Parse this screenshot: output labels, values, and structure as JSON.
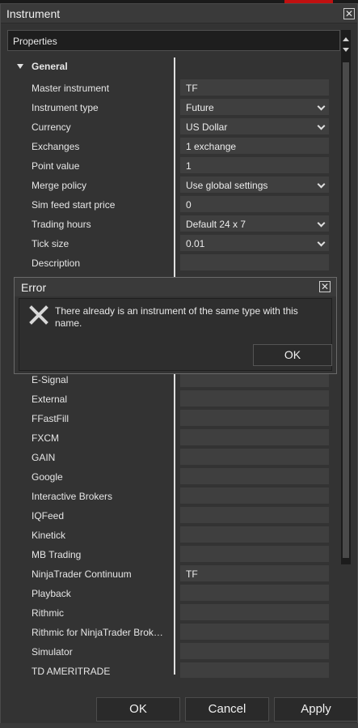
{
  "window": {
    "title": "Instrument"
  },
  "properties_header": "Properties",
  "category": "General",
  "rows": [
    {
      "label": "Master instrument",
      "value": "TF",
      "dropdown": false
    },
    {
      "label": "Instrument type",
      "value": "Future",
      "dropdown": true
    },
    {
      "label": "Currency",
      "value": "US Dollar",
      "dropdown": true
    },
    {
      "label": "Exchanges",
      "value": "1 exchange",
      "dropdown": false
    },
    {
      "label": "Point value",
      "value": "1",
      "dropdown": false
    },
    {
      "label": "Merge policy",
      "value": "Use global settings",
      "dropdown": true
    },
    {
      "label": "Sim feed start price",
      "value": "0",
      "dropdown": false
    },
    {
      "label": "Trading hours",
      "value": "Default 24 x 7",
      "dropdown": true
    },
    {
      "label": "Tick size",
      "value": "0.01",
      "dropdown": true
    },
    {
      "label": "Description",
      "value": "",
      "dropdown": false
    }
  ],
  "provider_rows": [
    {
      "label": "E-Signal",
      "value": ""
    },
    {
      "label": "External",
      "value": ""
    },
    {
      "label": "FFastFill",
      "value": ""
    },
    {
      "label": "FXCM",
      "value": ""
    },
    {
      "label": "GAIN",
      "value": ""
    },
    {
      "label": "Google",
      "value": ""
    },
    {
      "label": "Interactive Brokers",
      "value": ""
    },
    {
      "label": "IQFeed",
      "value": ""
    },
    {
      "label": "Kinetick",
      "value": ""
    },
    {
      "label": "MB Trading",
      "value": ""
    },
    {
      "label": "NinjaTrader Continuum",
      "value": "TF"
    },
    {
      "label": "Playback",
      "value": ""
    },
    {
      "label": "Rithmic",
      "value": ""
    },
    {
      "label": "Rithmic for NinjaTrader Brok…",
      "value": ""
    },
    {
      "label": "Simulator",
      "value": ""
    },
    {
      "label": "TD AMERITRADE",
      "value": ""
    }
  ],
  "error_dialog": {
    "title": "Error",
    "message": "There already is an instrument of the same type with this name.",
    "ok_label": "OK",
    "icon": "error-x-icon"
  },
  "buttons": {
    "ok": "OK",
    "cancel": "Cancel",
    "apply": "Apply"
  },
  "colors": {
    "window_bg": "#333333",
    "field_bg": "#3f3f3f",
    "text": "#e6e6e6",
    "accent_red": "#c01010"
  }
}
